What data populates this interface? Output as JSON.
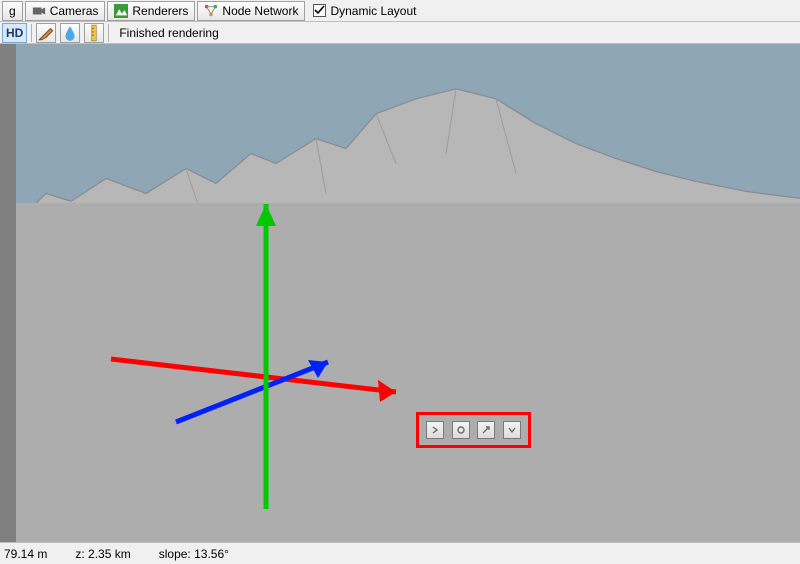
{
  "toolbar1": {
    "frag_label": "g",
    "cameras_label": "Cameras",
    "renderers_label": "Renderers",
    "node_network_label": "Node Network",
    "dynamic_layout_label": "Dynamic Layout",
    "dynamic_layout_checked": true
  },
  "toolbar2": {
    "hd_label": "HD",
    "status": "Finished rendering"
  },
  "statusbar": {
    "y": "79.14 m",
    "z_label": "z:",
    "z_value": "2.35 km",
    "slope_label": "slope:",
    "slope_value": "13.56°"
  },
  "colors": {
    "axis_x": "#ff0000",
    "axis_y": "#00c800",
    "axis_z": "#0020ff",
    "callout_border": "#ff0000"
  }
}
